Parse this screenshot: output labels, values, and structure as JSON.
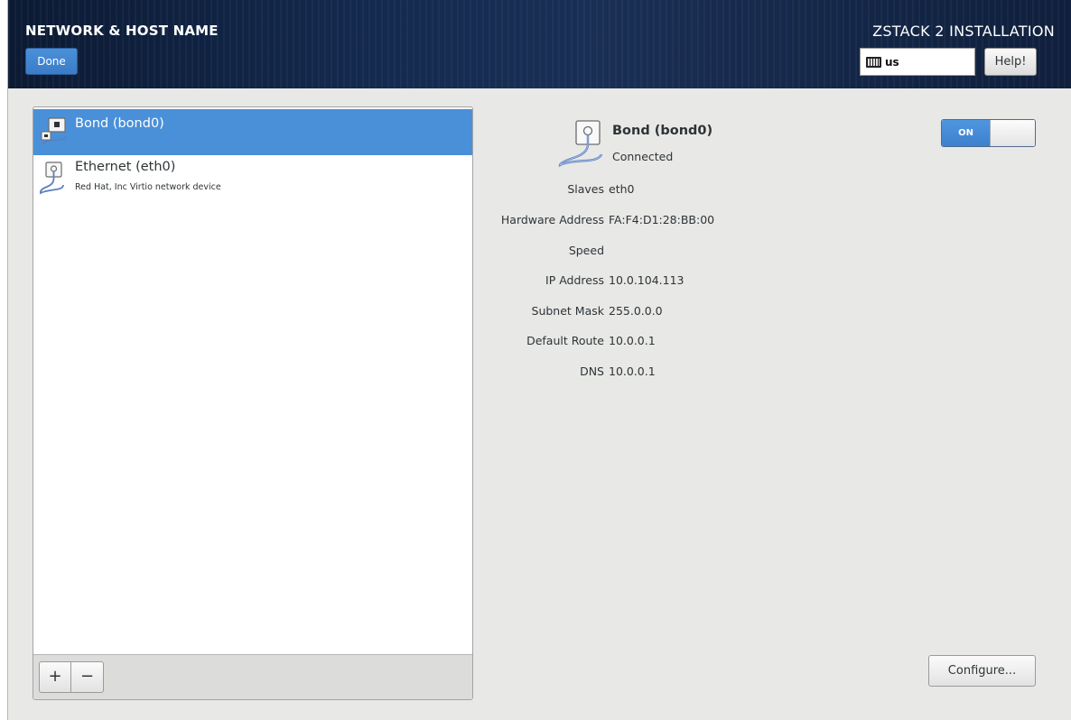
{
  "header": {
    "spoke_title": "NETWORK & HOST NAME",
    "done_label": "Done",
    "product_title": "ZSTACK 2 INSTALLATION",
    "keyboard_layout": "us",
    "help_label": "Help!"
  },
  "devices": [
    {
      "name": "Bond (bond0)",
      "description": "",
      "selected": true,
      "icon": "bond-icon"
    },
    {
      "name": "Ethernet (eth0)",
      "description": "Red Hat, Inc Virtio network device",
      "selected": false,
      "icon": "ethernet-icon"
    }
  ],
  "toolbar": {
    "add_label": "+",
    "remove_label": "−"
  },
  "details": {
    "name": "Bond (bond0)",
    "status": "Connected",
    "switch_label": "ON",
    "switch_on": true,
    "properties": {
      "slaves": {
        "label": "Slaves",
        "value": "eth0"
      },
      "hardware": {
        "label": "Hardware Address",
        "value": "FA:F4:D1:28:BB:00"
      },
      "speed": {
        "label": "Speed",
        "value": ""
      },
      "ip": {
        "label": "IP Address",
        "value": "10.0.104.113"
      },
      "subnet": {
        "label": "Subnet Mask",
        "value": "255.0.0.0"
      },
      "route": {
        "label": "Default Route",
        "value": "10.0.0.1"
      },
      "dns": {
        "label": "DNS",
        "value": "10.0.0.1"
      }
    },
    "configure_label": "Configure..."
  },
  "colors": {
    "header_bg": "#142a4f",
    "accent_blue": "#4a90d9",
    "panel_bg": "#e8e8e7"
  }
}
